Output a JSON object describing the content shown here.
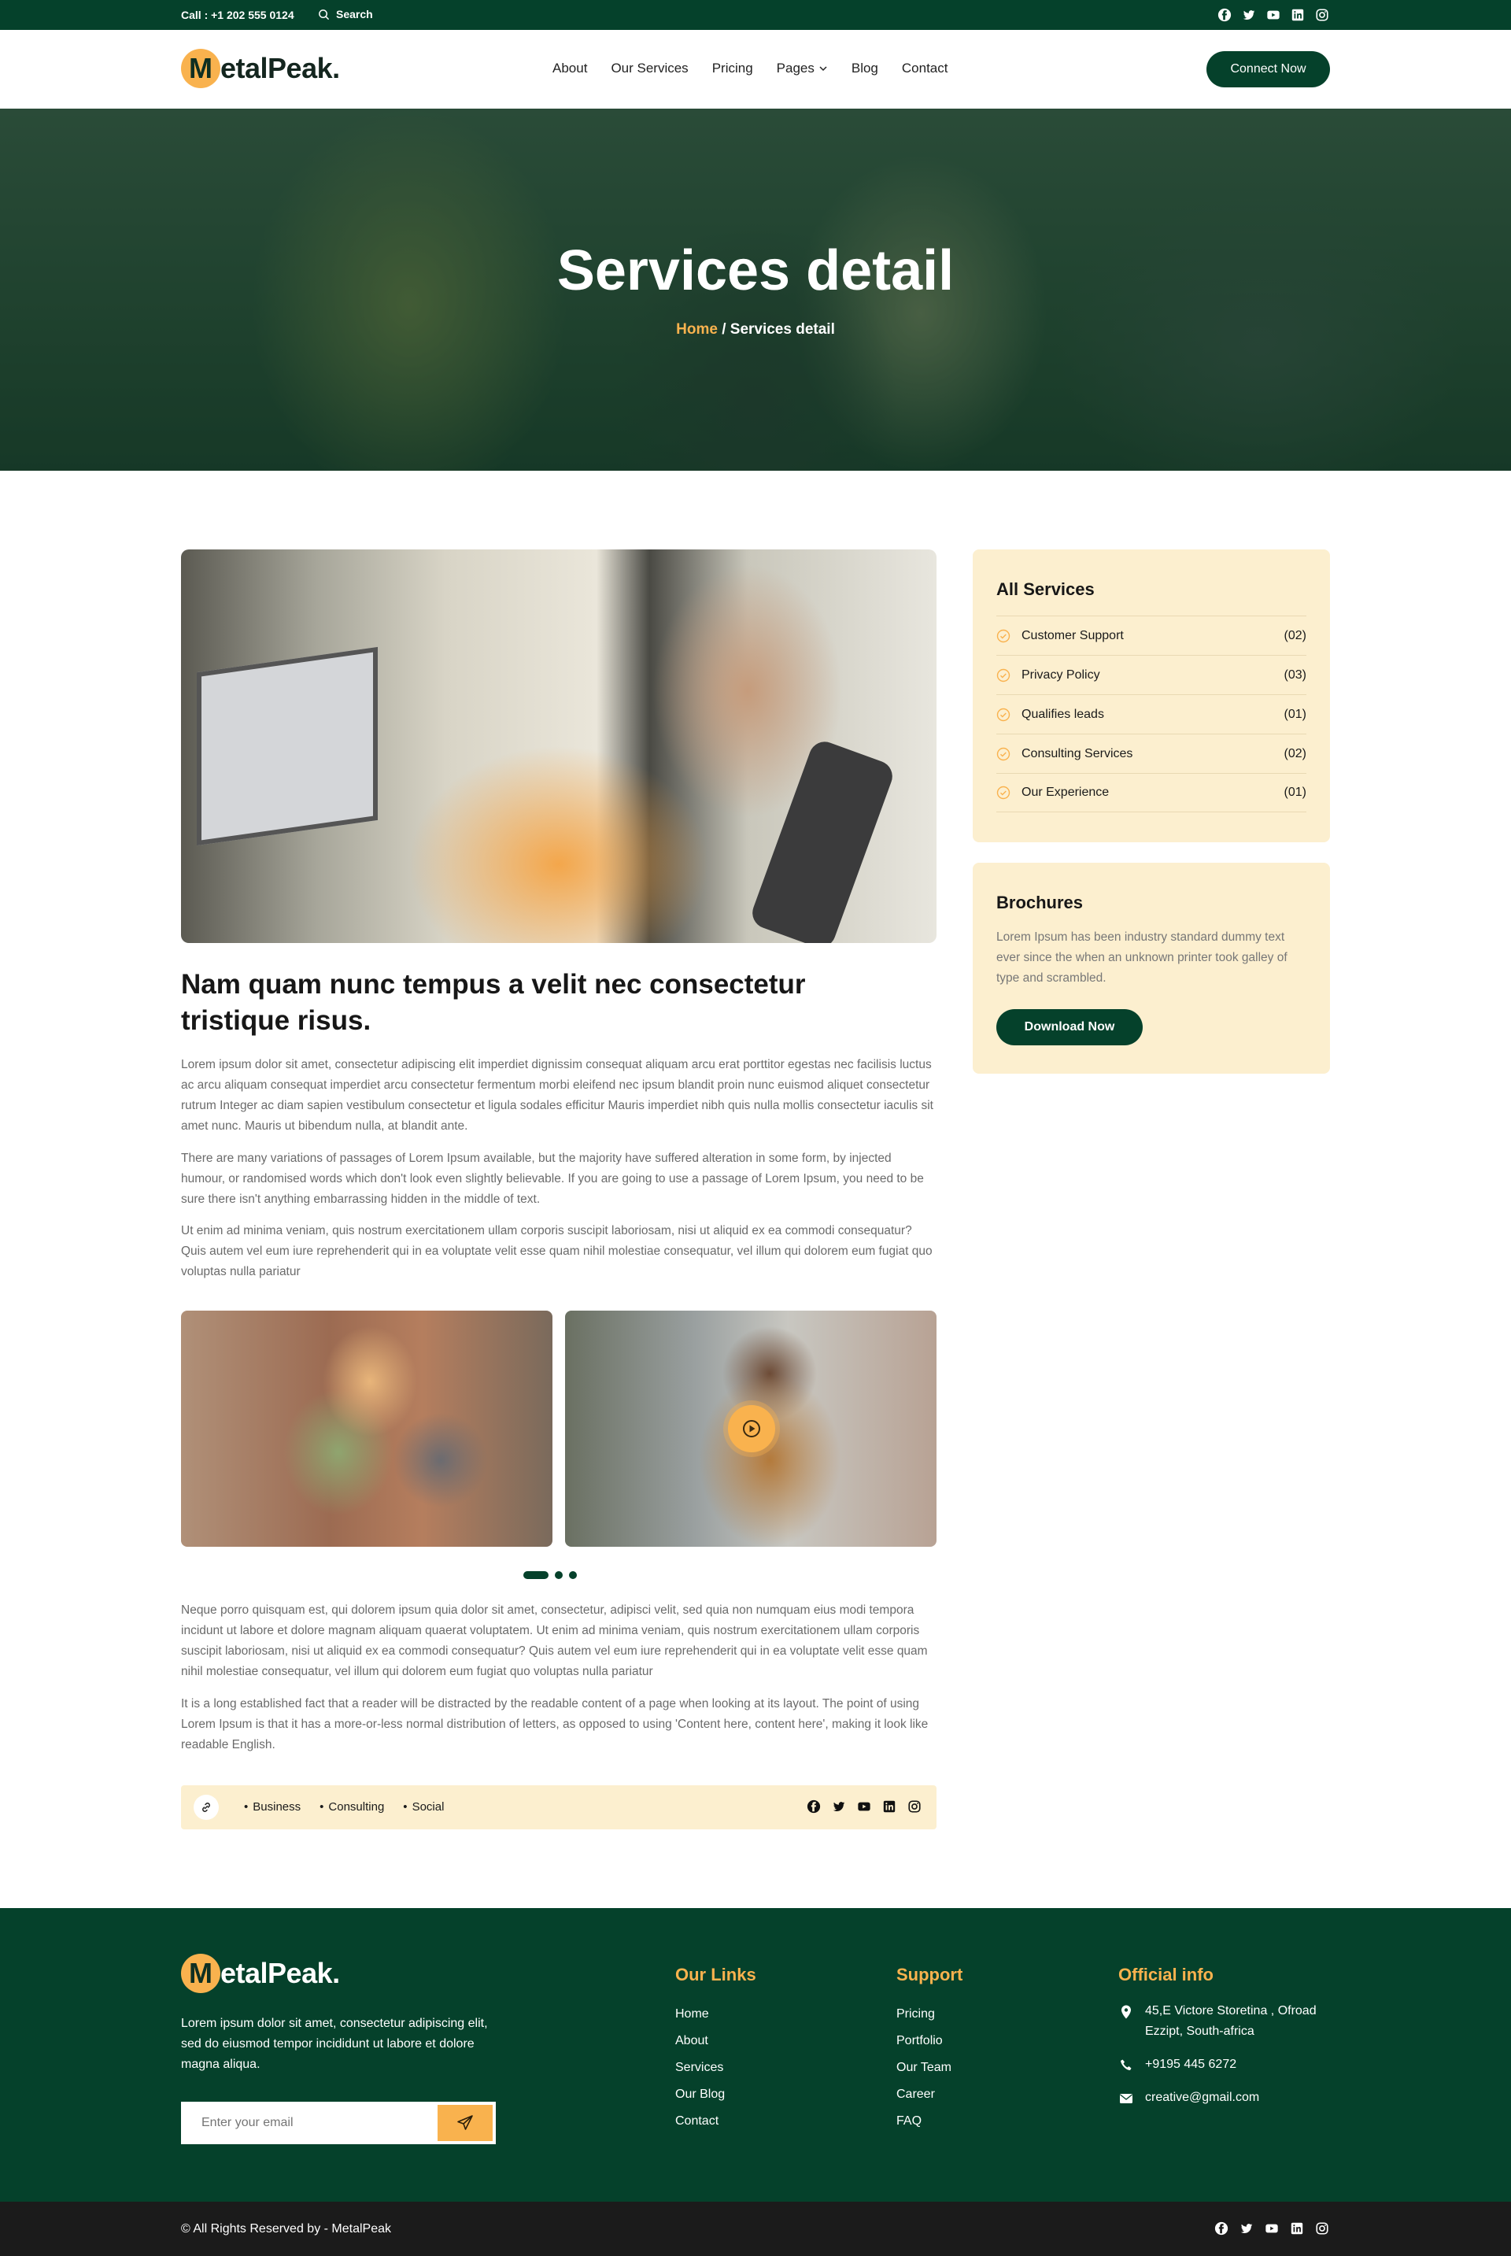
{
  "topbar": {
    "call": "Call : +1 202 555 0124",
    "search_label": "Search"
  },
  "brand": {
    "initial": "M",
    "rest": "etalPeak."
  },
  "nav": {
    "items": [
      "About",
      "Our Services",
      "Pricing",
      "Pages",
      "Blog",
      "Contact"
    ],
    "cta": "Connect Now"
  },
  "hero": {
    "title": "Services detail",
    "crumb_home": "Home",
    "crumb_sep": " / ",
    "crumb_current": "Services detail"
  },
  "article": {
    "title": "Nam quam nunc tempus a velit nec consectetur tristique risus.",
    "p1": "Lorem ipsum dolor sit amet, consectetur adipiscing elit  imperdiet dignissim consequat aliquam arcu erat porttitor egestas nec facilisis luctus ac arcu aliquam consequat imperdiet arcu consectetur fermentum morbi eleifend nec ipsum blandit proin nunc euismod aliquet consectetur rutrum Integer ac diam sapien vestibulum consectetur et ligula sodales efficitur Mauris imperdiet nibh quis nulla mollis consectetur iaculis sit amet nunc. Mauris ut bibendum nulla, at blandit ante.",
    "p2": "There are many variations of passages of Lorem Ipsum available, but the majority have suffered alteration in some form, by injected humour, or randomised words which don't look even slightly believable. If you are going to use a passage of Lorem Ipsum, you need to be sure there isn't anything embarrassing hidden in the middle of text.",
    "p3": "Ut enim ad minima veniam, quis nostrum exercitationem ullam corporis suscipit laboriosam, nisi ut aliquid ex ea commodi consequatur? Quis autem vel eum iure reprehenderit qui in ea voluptate velit esse quam nihil molestiae consequatur, vel illum qui dolorem eum fugiat quo voluptas nulla pariatur",
    "p4": "Neque porro quisquam est, qui dolorem ipsum quia dolor sit amet, consectetur, adipisci velit, sed quia non numquam eius modi tempora incidunt ut labore et dolore magnam aliquam quaerat voluptatem. Ut enim ad minima veniam, quis nostrum exercitationem ullam corporis suscipit laboriosam, nisi ut aliquid ex ea commodi consequatur? Quis autem vel eum iure reprehenderit qui in ea voluptate velit esse quam nihil molestiae consequatur, vel illum qui dolorem eum fugiat quo voluptas nulla pariatur",
    "p5": "It is a long established fact that a reader will be distracted by the readable content of a page when looking at its layout. The point of using Lorem Ipsum is that it has a more-or-less normal distribution of letters, as opposed to using 'Content here, content here', making it look like readable English.",
    "tags": [
      "Business",
      "Consulting",
      "Social"
    ]
  },
  "sidebar": {
    "services_title": "All Services",
    "services": [
      {
        "name": "Customer Support",
        "count": "(02)"
      },
      {
        "name": "Privacy Policy",
        "count": "(03)"
      },
      {
        "name": "Qualifies leads",
        "count": "(01)"
      },
      {
        "name": "Consulting Services",
        "count": "(02)"
      },
      {
        "name": "Our Experience",
        "count": "(01)"
      }
    ],
    "brochures_title": "Brochures",
    "brochures_text": "Lorem Ipsum has been industry standard dummy text ever since the when an unknown printer took galley of type and scrambled.",
    "download": "Download Now"
  },
  "footer": {
    "about": "Lorem ipsum dolor sit amet, consectetur adipiscing elit, sed do eiusmod tempor incididunt ut labore et dolore magna aliqua.",
    "email_placeholder": "Enter your email",
    "links_title": "Our Links",
    "links": [
      "Home",
      "About",
      "Services",
      "Our Blog",
      "Contact"
    ],
    "support_title": "Support",
    "support": [
      "Pricing",
      "Portfolio",
      "Our Team",
      "Career",
      "FAQ"
    ],
    "info_title": "Official info",
    "address": "45,E Victore Storetina , Ofroad Ezzipt, South-africa",
    "phone": "+9195 445 6272",
    "email": "creative@gmail.com",
    "copyright": "© All Rights Reserved by - MetalPeak"
  },
  "colors": {
    "primary": "#05412b",
    "accent": "#f9b24e",
    "cream": "#fcefcf"
  },
  "icons": [
    "search-icon",
    "facebook-icon",
    "twitter-icon",
    "youtube-icon",
    "linkedin-icon",
    "instagram-icon",
    "chevron-down-icon",
    "check-circle-icon",
    "play-icon",
    "link-icon",
    "send-icon",
    "location-icon",
    "phone-icon",
    "mail-icon"
  ]
}
